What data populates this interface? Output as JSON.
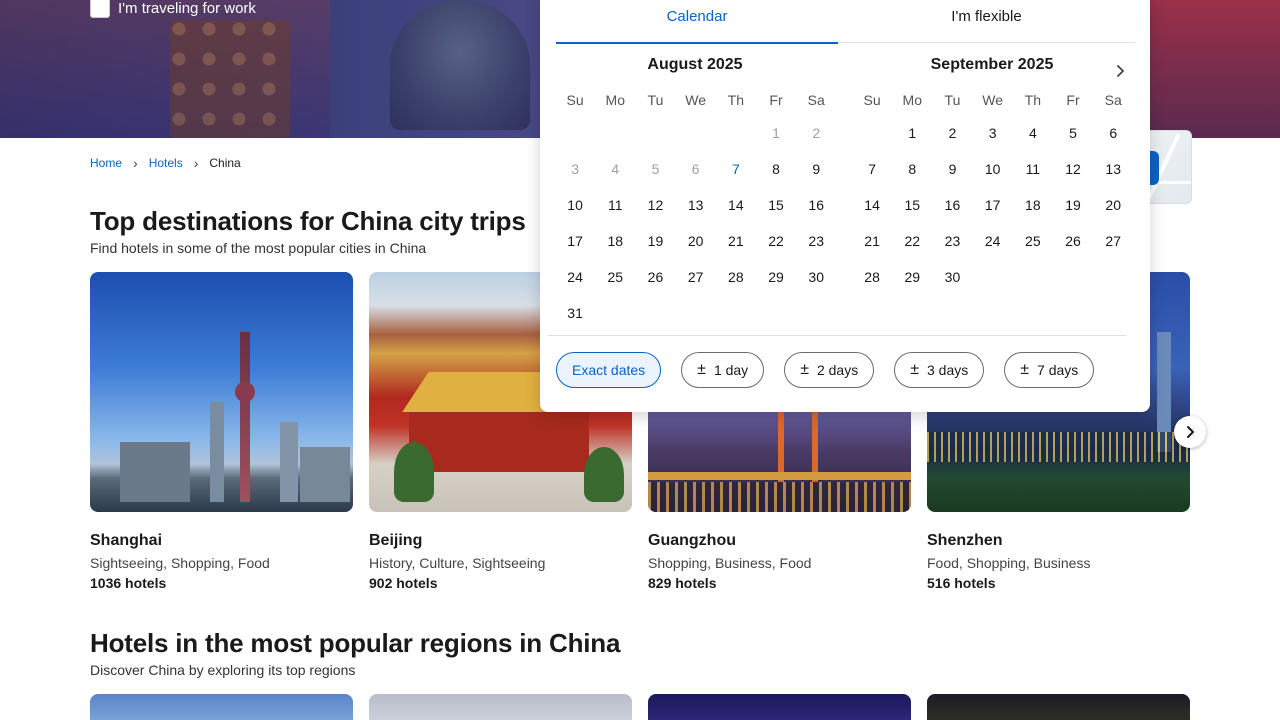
{
  "work_checkbox": {
    "label": "I'm traveling for work",
    "checked": false
  },
  "breadcrumb": {
    "items": [
      "Home",
      "Hotels",
      "China"
    ]
  },
  "section1": {
    "title": "Top destinations for China city trips",
    "subtitle": "Find hotels in some of the most popular cities in China"
  },
  "cities": [
    {
      "name": "Shanghai",
      "tags": "Sightseeing, Shopping, Food",
      "count": "1036 hotels"
    },
    {
      "name": "Beijing",
      "tags": "History, Culture, Sightseeing",
      "count": "902 hotels"
    },
    {
      "name": "Guangzhou",
      "tags": "Shopping, Business, Food",
      "count": "829 hotels"
    },
    {
      "name": "Shenzhen",
      "tags": "Food, Shopping, Business",
      "count": "516 hotels"
    }
  ],
  "section2": {
    "title": "Hotels in the most popular regions in China",
    "subtitle": "Discover China by exploring its top regions"
  },
  "calendar": {
    "tabs": [
      "Calendar",
      "I'm flexible"
    ],
    "active_tab": "Calendar",
    "weekdays": [
      "Su",
      "Mo",
      "Tu",
      "We",
      "Th",
      "Fr",
      "Sa"
    ],
    "months": [
      {
        "title": "August 2025",
        "leading_blanks": 5,
        "days": 31,
        "past_through": 6,
        "today": 7
      },
      {
        "title": "September 2025",
        "leading_blanks": 1,
        "days": 30,
        "past_through": 0,
        "today": null
      }
    ],
    "chips": [
      {
        "label": "Exact dates",
        "selected": true,
        "plusminus": false
      },
      {
        "label": "1 day",
        "selected": false,
        "plusminus": true
      },
      {
        "label": "2 days",
        "selected": false,
        "plusminus": true
      },
      {
        "label": "3 days",
        "selected": false,
        "plusminus": true
      },
      {
        "label": "7 days",
        "selected": false,
        "plusminus": true
      }
    ],
    "plusminus_symbol": "±"
  },
  "colors": {
    "link_blue": "#0b62c4",
    "chip_selected_bg": "#ebf3ff"
  }
}
